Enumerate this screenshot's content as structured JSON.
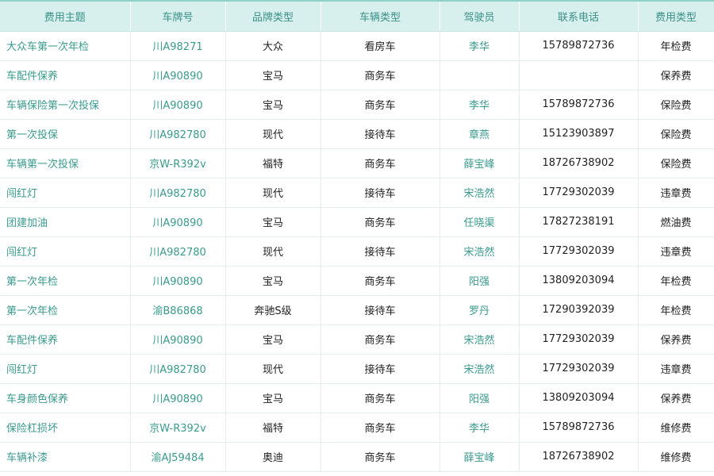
{
  "columns": [
    "费用主题",
    "车牌号",
    "品牌类型",
    "车辆类型",
    "驾驶员",
    "联系电话",
    "费用类型"
  ],
  "rows": [
    {
      "subject": "大众车第一次年检",
      "plate": "川A98271",
      "brand": "大众",
      "vehicle_type": "看房车",
      "driver": "李华",
      "phone": "15789872736",
      "fee_type": "年检费"
    },
    {
      "subject": "车配件保养",
      "plate": "川A90890",
      "brand": "宝马",
      "vehicle_type": "商务车",
      "driver": "",
      "phone": "",
      "fee_type": "保养费"
    },
    {
      "subject": "车辆保险第一次投保",
      "plate": "川A90890",
      "brand": "宝马",
      "vehicle_type": "商务车",
      "driver": "李华",
      "phone": "15789872736",
      "fee_type": "保险费"
    },
    {
      "subject": "第一次投保",
      "plate": "川A982780",
      "brand": "现代",
      "vehicle_type": "接待车",
      "driver": "章燕",
      "phone": "15123903897",
      "fee_type": "保险费"
    },
    {
      "subject": "车辆第一次投保",
      "plate": "京W-R392v",
      "brand": "福特",
      "vehicle_type": "商务车",
      "driver": "薛宝峰",
      "phone": "18726738902",
      "fee_type": "保险费"
    },
    {
      "subject": "闯红灯",
      "plate": "川A982780",
      "brand": "现代",
      "vehicle_type": "接待车",
      "driver": "宋浩然",
      "phone": "17729302039",
      "fee_type": "违章费"
    },
    {
      "subject": "团建加油",
      "plate": "川A90890",
      "brand": "宝马",
      "vehicle_type": "商务车",
      "driver": "任晓渠",
      "phone": "17827238191",
      "fee_type": "燃油费"
    },
    {
      "subject": "闯红灯",
      "plate": "川A982780",
      "brand": "现代",
      "vehicle_type": "接待车",
      "driver": "宋浩然",
      "phone": "17729302039",
      "fee_type": "违章费"
    },
    {
      "subject": "第一次年检",
      "plate": "川A90890",
      "brand": "宝马",
      "vehicle_type": "商务车",
      "driver": "阳强",
      "phone": "13809203094",
      "fee_type": "年检费"
    },
    {
      "subject": "第一次年检",
      "plate": "渝B86868",
      "brand": "奔驰S级",
      "vehicle_type": "接待车",
      "driver": "罗丹",
      "phone": "17290392039",
      "fee_type": "年检费"
    },
    {
      "subject": "车配件保养",
      "plate": "川A90890",
      "brand": "宝马",
      "vehicle_type": "商务车",
      "driver": "宋浩然",
      "phone": "17729302039",
      "fee_type": "保养费"
    },
    {
      "subject": "闯红灯",
      "plate": "川A982780",
      "brand": "现代",
      "vehicle_type": "接待车",
      "driver": "宋浩然",
      "phone": "17729302039",
      "fee_type": "违章费"
    },
    {
      "subject": "车身颜色保养",
      "plate": "川A90890",
      "brand": "宝马",
      "vehicle_type": "商务车",
      "driver": "阳强",
      "phone": "13809203094",
      "fee_type": "保养费"
    },
    {
      "subject": "保险杠损坏",
      "plate": "京W-R392v",
      "brand": "福特",
      "vehicle_type": "商务车",
      "driver": "李华",
      "phone": "15789872736",
      "fee_type": "维修费"
    },
    {
      "subject": "车辆补漆",
      "plate": "渝AJ59484",
      "brand": "奥迪",
      "vehicle_type": "商务车",
      "driver": "薛宝峰",
      "phone": "18726738902",
      "fee_type": "维修费"
    }
  ]
}
